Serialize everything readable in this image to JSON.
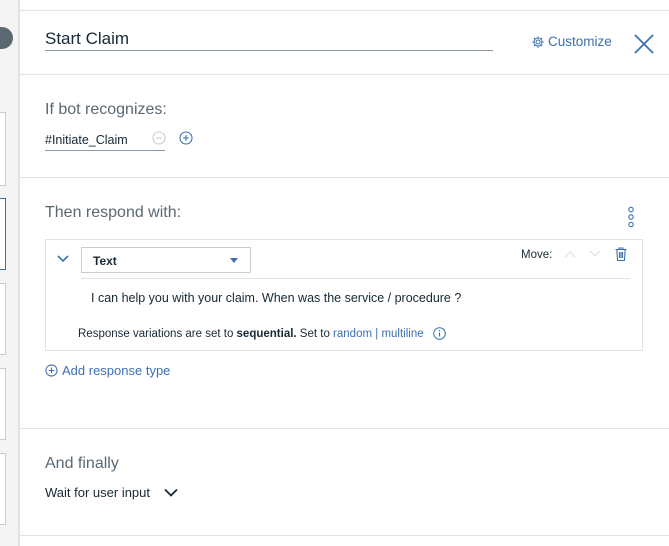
{
  "header": {
    "title_value": "Start Claim",
    "customize_label": "Customize"
  },
  "condition": {
    "label": "If bot recognizes:",
    "intent_value": "#Initiate_Claim"
  },
  "response": {
    "label": "Then respond with:",
    "type_selected": "Text",
    "move_label": "Move:",
    "text_value": "I can help you with your claim. When was the service / procedure ?",
    "variations_prefix": "Response variations are set to ",
    "variations_mode": "sequential.",
    "variations_set_to": " Set to ",
    "option_random": "random",
    "option_separator": " | ",
    "option_multiline": "multiline",
    "add_label": "Add response type"
  },
  "finally": {
    "label": "And finally",
    "action_selected": "Wait for user input"
  },
  "colors": {
    "accent": "#3d70b2",
    "text": "#152935",
    "muted": "#5a6872",
    "border": "#dfe3e6"
  }
}
